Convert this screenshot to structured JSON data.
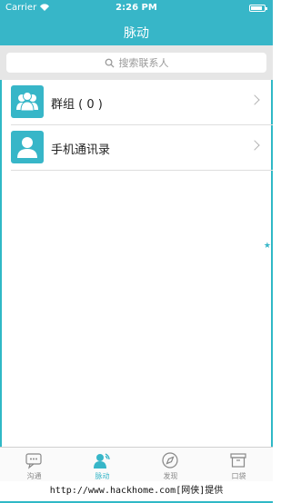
{
  "status_bar": {
    "carrier": "Carrier",
    "time": "2:26 PM",
    "battery_level": 0.85
  },
  "header": {
    "title": "脉动"
  },
  "search": {
    "placeholder": "搜索联系人"
  },
  "list": {
    "items": [
      {
        "label": "群组 ( 0 )",
        "icon": "group-icon"
      },
      {
        "label": "手机通讯录",
        "icon": "contact-icon"
      }
    ]
  },
  "tabbar": {
    "tabs": [
      {
        "label": "沟通",
        "icon": "chat-icon",
        "active": false
      },
      {
        "label": "脉动",
        "icon": "person-signal-icon",
        "active": true
      },
      {
        "label": "发现",
        "icon": "compass-icon",
        "active": false
      },
      {
        "label": "口袋",
        "icon": "box-icon",
        "active": false
      }
    ]
  },
  "footer": {
    "text": "http://www.hackhome.com[网侠]提供"
  },
  "colors": {
    "accent": "#37b6c8",
    "search_bg": "#e6e6e6",
    "divider": "#dedede",
    "tab_inactive": "#888888"
  }
}
